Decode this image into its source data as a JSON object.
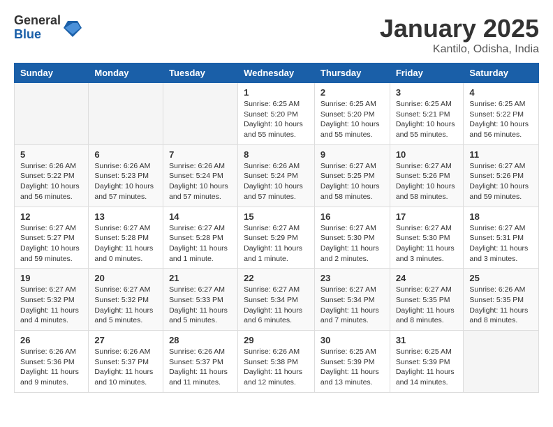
{
  "logo": {
    "general": "General",
    "blue": "Blue"
  },
  "header": {
    "month": "January 2025",
    "location": "Kantilo, Odisha, India"
  },
  "weekdays": [
    "Sunday",
    "Monday",
    "Tuesday",
    "Wednesday",
    "Thursday",
    "Friday",
    "Saturday"
  ],
  "weeks": [
    [
      {
        "day": "",
        "info": ""
      },
      {
        "day": "",
        "info": ""
      },
      {
        "day": "",
        "info": ""
      },
      {
        "day": "1",
        "info": "Sunrise: 6:25 AM\nSunset: 5:20 PM\nDaylight: 10 hours\nand 55 minutes."
      },
      {
        "day": "2",
        "info": "Sunrise: 6:25 AM\nSunset: 5:20 PM\nDaylight: 10 hours\nand 55 minutes."
      },
      {
        "day": "3",
        "info": "Sunrise: 6:25 AM\nSunset: 5:21 PM\nDaylight: 10 hours\nand 55 minutes."
      },
      {
        "day": "4",
        "info": "Sunrise: 6:25 AM\nSunset: 5:22 PM\nDaylight: 10 hours\nand 56 minutes."
      }
    ],
    [
      {
        "day": "5",
        "info": "Sunrise: 6:26 AM\nSunset: 5:22 PM\nDaylight: 10 hours\nand 56 minutes."
      },
      {
        "day": "6",
        "info": "Sunrise: 6:26 AM\nSunset: 5:23 PM\nDaylight: 10 hours\nand 57 minutes."
      },
      {
        "day": "7",
        "info": "Sunrise: 6:26 AM\nSunset: 5:24 PM\nDaylight: 10 hours\nand 57 minutes."
      },
      {
        "day": "8",
        "info": "Sunrise: 6:26 AM\nSunset: 5:24 PM\nDaylight: 10 hours\nand 57 minutes."
      },
      {
        "day": "9",
        "info": "Sunrise: 6:27 AM\nSunset: 5:25 PM\nDaylight: 10 hours\nand 58 minutes."
      },
      {
        "day": "10",
        "info": "Sunrise: 6:27 AM\nSunset: 5:26 PM\nDaylight: 10 hours\nand 58 minutes."
      },
      {
        "day": "11",
        "info": "Sunrise: 6:27 AM\nSunset: 5:26 PM\nDaylight: 10 hours\nand 59 minutes."
      }
    ],
    [
      {
        "day": "12",
        "info": "Sunrise: 6:27 AM\nSunset: 5:27 PM\nDaylight: 10 hours\nand 59 minutes."
      },
      {
        "day": "13",
        "info": "Sunrise: 6:27 AM\nSunset: 5:28 PM\nDaylight: 11 hours\nand 0 minutes."
      },
      {
        "day": "14",
        "info": "Sunrise: 6:27 AM\nSunset: 5:28 PM\nDaylight: 11 hours\nand 1 minute."
      },
      {
        "day": "15",
        "info": "Sunrise: 6:27 AM\nSunset: 5:29 PM\nDaylight: 11 hours\nand 1 minute."
      },
      {
        "day": "16",
        "info": "Sunrise: 6:27 AM\nSunset: 5:30 PM\nDaylight: 11 hours\nand 2 minutes."
      },
      {
        "day": "17",
        "info": "Sunrise: 6:27 AM\nSunset: 5:30 PM\nDaylight: 11 hours\nand 3 minutes."
      },
      {
        "day": "18",
        "info": "Sunrise: 6:27 AM\nSunset: 5:31 PM\nDaylight: 11 hours\nand 3 minutes."
      }
    ],
    [
      {
        "day": "19",
        "info": "Sunrise: 6:27 AM\nSunset: 5:32 PM\nDaylight: 11 hours\nand 4 minutes."
      },
      {
        "day": "20",
        "info": "Sunrise: 6:27 AM\nSunset: 5:32 PM\nDaylight: 11 hours\nand 5 minutes."
      },
      {
        "day": "21",
        "info": "Sunrise: 6:27 AM\nSunset: 5:33 PM\nDaylight: 11 hours\nand 5 minutes."
      },
      {
        "day": "22",
        "info": "Sunrise: 6:27 AM\nSunset: 5:34 PM\nDaylight: 11 hours\nand 6 minutes."
      },
      {
        "day": "23",
        "info": "Sunrise: 6:27 AM\nSunset: 5:34 PM\nDaylight: 11 hours\nand 7 minutes."
      },
      {
        "day": "24",
        "info": "Sunrise: 6:27 AM\nSunset: 5:35 PM\nDaylight: 11 hours\nand 8 minutes."
      },
      {
        "day": "25",
        "info": "Sunrise: 6:26 AM\nSunset: 5:35 PM\nDaylight: 11 hours\nand 8 minutes."
      }
    ],
    [
      {
        "day": "26",
        "info": "Sunrise: 6:26 AM\nSunset: 5:36 PM\nDaylight: 11 hours\nand 9 minutes."
      },
      {
        "day": "27",
        "info": "Sunrise: 6:26 AM\nSunset: 5:37 PM\nDaylight: 11 hours\nand 10 minutes."
      },
      {
        "day": "28",
        "info": "Sunrise: 6:26 AM\nSunset: 5:37 PM\nDaylight: 11 hours\nand 11 minutes."
      },
      {
        "day": "29",
        "info": "Sunrise: 6:26 AM\nSunset: 5:38 PM\nDaylight: 11 hours\nand 12 minutes."
      },
      {
        "day": "30",
        "info": "Sunrise: 6:25 AM\nSunset: 5:39 PM\nDaylight: 11 hours\nand 13 minutes."
      },
      {
        "day": "31",
        "info": "Sunrise: 6:25 AM\nSunset: 5:39 PM\nDaylight: 11 hours\nand 14 minutes."
      },
      {
        "day": "",
        "info": ""
      }
    ]
  ]
}
